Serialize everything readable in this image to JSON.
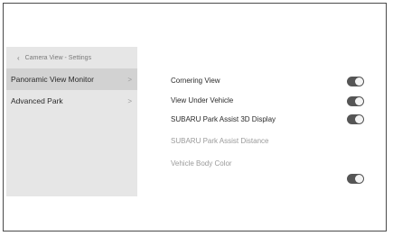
{
  "breadcrumb": {
    "back_icon": "chevron-left-icon",
    "label": "Camera View - Settings"
  },
  "sidebar": {
    "items": [
      {
        "label": "Panoramic View Monitor",
        "chevron": ">",
        "selected": true
      },
      {
        "label": "Advanced Park",
        "chevron": ">",
        "selected": false
      }
    ]
  },
  "settings": [
    {
      "label": "Cornering View",
      "toggle_on": true,
      "enabled": true
    },
    {
      "label": "View Under Vehicle",
      "toggle_on": true,
      "enabled": true
    },
    {
      "label": "SUBARU Park Assist 3D Display",
      "toggle_on": true,
      "enabled": true
    },
    {
      "label": "SUBARU Park Assist Distance",
      "enabled": false
    },
    {
      "label": "Vehicle Body Color",
      "enabled": false
    }
  ],
  "extra_toggle": {
    "toggle_on": true
  },
  "colors": {
    "toggle_on": "#555555",
    "sidebar_bg": "#e6e6e6",
    "selected_bg": "#d2d2d2"
  }
}
